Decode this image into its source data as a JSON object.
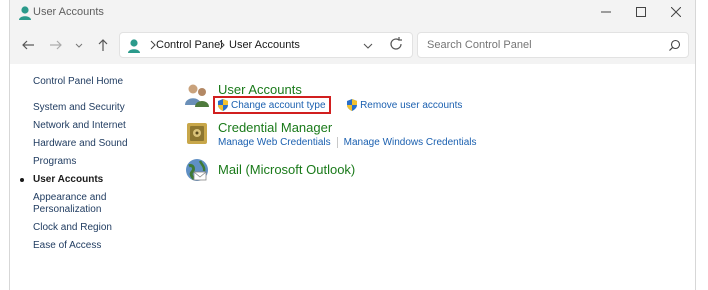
{
  "window": {
    "title": "User Accounts"
  },
  "address": {
    "crumbs": [
      "Control Panel",
      "User Accounts"
    ]
  },
  "search": {
    "placeholder": "Search Control Panel"
  },
  "sidebar": {
    "home": "Control Panel Home",
    "items": [
      {
        "label": "System and Security",
        "active": false
      },
      {
        "label": "Network and Internet",
        "active": false
      },
      {
        "label": "Hardware and Sound",
        "active": false
      },
      {
        "label": "Programs",
        "active": false
      },
      {
        "label": "User Accounts",
        "active": true
      },
      {
        "label": "Appearance and Personalization",
        "active": false
      },
      {
        "label": "Clock and Region",
        "active": false
      },
      {
        "label": "Ease of Access",
        "active": false
      }
    ]
  },
  "categories": [
    {
      "title": "User Accounts",
      "icon": "users-icon",
      "links": [
        "Change account type",
        "Remove user accounts"
      ]
    },
    {
      "title": "Credential Manager",
      "icon": "credential-vault-icon",
      "links": [
        "Manage Web Credentials",
        "Manage Windows Credentials"
      ]
    },
    {
      "title": "Mail (Microsoft Outlook)",
      "icon": "mail-globe-icon",
      "links": []
    }
  ],
  "colors": {
    "category_title": "#1a7a1a",
    "link": "#1b60b0",
    "highlight": "#d11f1f"
  }
}
